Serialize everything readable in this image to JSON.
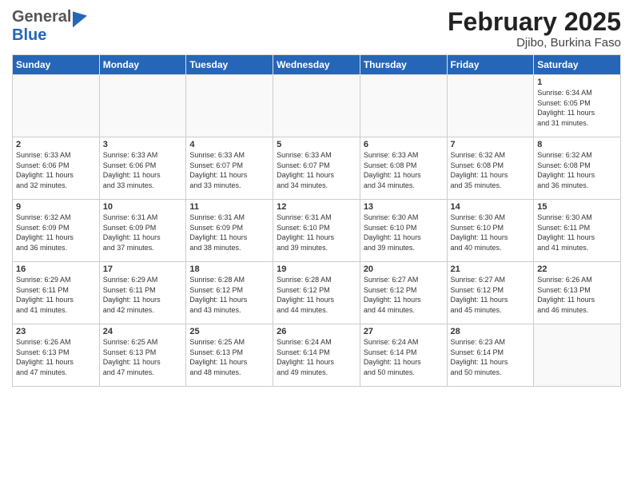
{
  "header": {
    "logo_general": "General",
    "logo_blue": "Blue",
    "title": "February 2025",
    "location": "Djibo, Burkina Faso"
  },
  "days_of_week": [
    "Sunday",
    "Monday",
    "Tuesday",
    "Wednesday",
    "Thursday",
    "Friday",
    "Saturday"
  ],
  "weeks": [
    [
      {
        "day": "",
        "info": ""
      },
      {
        "day": "",
        "info": ""
      },
      {
        "day": "",
        "info": ""
      },
      {
        "day": "",
        "info": ""
      },
      {
        "day": "",
        "info": ""
      },
      {
        "day": "",
        "info": ""
      },
      {
        "day": "1",
        "info": "Sunrise: 6:34 AM\nSunset: 6:05 PM\nDaylight: 11 hours\nand 31 minutes."
      }
    ],
    [
      {
        "day": "2",
        "info": "Sunrise: 6:33 AM\nSunset: 6:06 PM\nDaylight: 11 hours\nand 32 minutes."
      },
      {
        "day": "3",
        "info": "Sunrise: 6:33 AM\nSunset: 6:06 PM\nDaylight: 11 hours\nand 33 minutes."
      },
      {
        "day": "4",
        "info": "Sunrise: 6:33 AM\nSunset: 6:07 PM\nDaylight: 11 hours\nand 33 minutes."
      },
      {
        "day": "5",
        "info": "Sunrise: 6:33 AM\nSunset: 6:07 PM\nDaylight: 11 hours\nand 34 minutes."
      },
      {
        "day": "6",
        "info": "Sunrise: 6:33 AM\nSunset: 6:08 PM\nDaylight: 11 hours\nand 34 minutes."
      },
      {
        "day": "7",
        "info": "Sunrise: 6:32 AM\nSunset: 6:08 PM\nDaylight: 11 hours\nand 35 minutes."
      },
      {
        "day": "8",
        "info": "Sunrise: 6:32 AM\nSunset: 6:08 PM\nDaylight: 11 hours\nand 36 minutes."
      }
    ],
    [
      {
        "day": "9",
        "info": "Sunrise: 6:32 AM\nSunset: 6:09 PM\nDaylight: 11 hours\nand 36 minutes."
      },
      {
        "day": "10",
        "info": "Sunrise: 6:31 AM\nSunset: 6:09 PM\nDaylight: 11 hours\nand 37 minutes."
      },
      {
        "day": "11",
        "info": "Sunrise: 6:31 AM\nSunset: 6:09 PM\nDaylight: 11 hours\nand 38 minutes."
      },
      {
        "day": "12",
        "info": "Sunrise: 6:31 AM\nSunset: 6:10 PM\nDaylight: 11 hours\nand 39 minutes."
      },
      {
        "day": "13",
        "info": "Sunrise: 6:30 AM\nSunset: 6:10 PM\nDaylight: 11 hours\nand 39 minutes."
      },
      {
        "day": "14",
        "info": "Sunrise: 6:30 AM\nSunset: 6:10 PM\nDaylight: 11 hours\nand 40 minutes."
      },
      {
        "day": "15",
        "info": "Sunrise: 6:30 AM\nSunset: 6:11 PM\nDaylight: 11 hours\nand 41 minutes."
      }
    ],
    [
      {
        "day": "16",
        "info": "Sunrise: 6:29 AM\nSunset: 6:11 PM\nDaylight: 11 hours\nand 41 minutes."
      },
      {
        "day": "17",
        "info": "Sunrise: 6:29 AM\nSunset: 6:11 PM\nDaylight: 11 hours\nand 42 minutes."
      },
      {
        "day": "18",
        "info": "Sunrise: 6:28 AM\nSunset: 6:12 PM\nDaylight: 11 hours\nand 43 minutes."
      },
      {
        "day": "19",
        "info": "Sunrise: 6:28 AM\nSunset: 6:12 PM\nDaylight: 11 hours\nand 44 minutes."
      },
      {
        "day": "20",
        "info": "Sunrise: 6:27 AM\nSunset: 6:12 PM\nDaylight: 11 hours\nand 44 minutes."
      },
      {
        "day": "21",
        "info": "Sunrise: 6:27 AM\nSunset: 6:12 PM\nDaylight: 11 hours\nand 45 minutes."
      },
      {
        "day": "22",
        "info": "Sunrise: 6:26 AM\nSunset: 6:13 PM\nDaylight: 11 hours\nand 46 minutes."
      }
    ],
    [
      {
        "day": "23",
        "info": "Sunrise: 6:26 AM\nSunset: 6:13 PM\nDaylight: 11 hours\nand 47 minutes."
      },
      {
        "day": "24",
        "info": "Sunrise: 6:25 AM\nSunset: 6:13 PM\nDaylight: 11 hours\nand 47 minutes."
      },
      {
        "day": "25",
        "info": "Sunrise: 6:25 AM\nSunset: 6:13 PM\nDaylight: 11 hours\nand 48 minutes."
      },
      {
        "day": "26",
        "info": "Sunrise: 6:24 AM\nSunset: 6:14 PM\nDaylight: 11 hours\nand 49 minutes."
      },
      {
        "day": "27",
        "info": "Sunrise: 6:24 AM\nSunset: 6:14 PM\nDaylight: 11 hours\nand 50 minutes."
      },
      {
        "day": "28",
        "info": "Sunrise: 6:23 AM\nSunset: 6:14 PM\nDaylight: 11 hours\nand 50 minutes."
      },
      {
        "day": "",
        "info": ""
      }
    ]
  ]
}
